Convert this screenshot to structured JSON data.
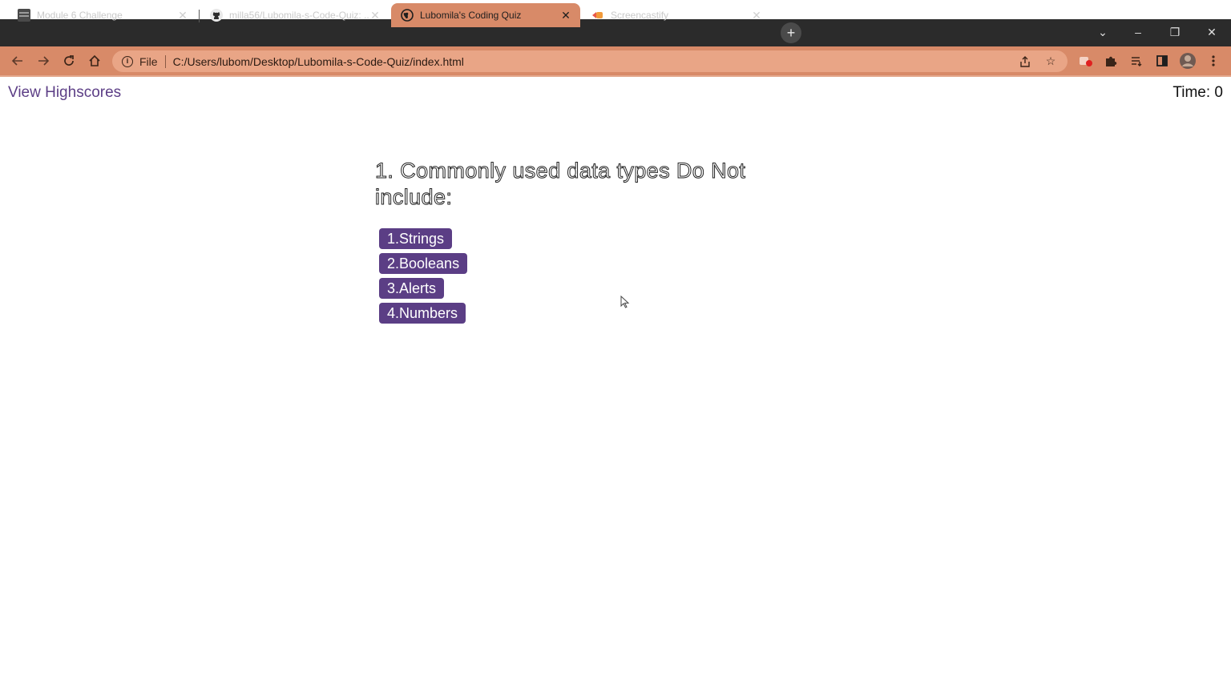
{
  "browser": {
    "tabs": [
      {
        "title": "Module 6 Challenge",
        "icon": "document-icon",
        "active": false
      },
      {
        "title": "milla56/Lubomila-s-Code-Quiz: ...",
        "icon": "github-icon",
        "active": false
      },
      {
        "title": "Lubomila's Coding Quiz",
        "icon": "globe-icon",
        "active": true
      },
      {
        "title": "Screencastify",
        "icon": "screencastify-icon",
        "active": false
      }
    ],
    "address": {
      "scheme_label": "File",
      "url": "C:/Users/lubom/Desktop/Lubomila-s-Code-Quiz/index.html"
    },
    "accent_color": "#d88a68",
    "tabbar_color": "#2b2b2b"
  },
  "page": {
    "highscores_link": "View Highscores",
    "timer_label": "Time: 0",
    "question": "1. Commonly used data types Do Not include:",
    "choices": [
      "1.Strings",
      "2.Booleans",
      "3.Alerts",
      "4.Numbers"
    ],
    "button_color": "#5b3e85",
    "link_color": "#5c3e86"
  }
}
